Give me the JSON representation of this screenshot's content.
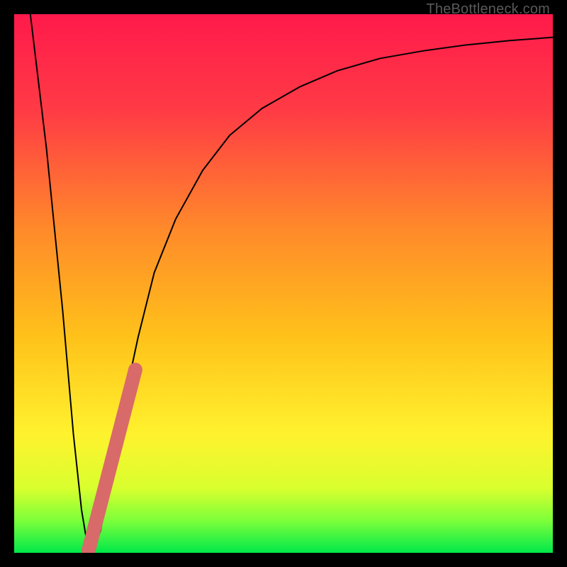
{
  "watermark": "TheBottleneck.com",
  "colors": {
    "frame": "#000000",
    "gradient_stops": [
      {
        "pct": 0,
        "color": "#ff1a4b"
      },
      {
        "pct": 18,
        "color": "#ff3b45"
      },
      {
        "pct": 40,
        "color": "#ff8a2a"
      },
      {
        "pct": 60,
        "color": "#ffc21a"
      },
      {
        "pct": 78,
        "color": "#fff22e"
      },
      {
        "pct": 88,
        "color": "#d9ff2e"
      },
      {
        "pct": 94,
        "color": "#7dff3a"
      },
      {
        "pct": 100,
        "color": "#00e84a"
      }
    ],
    "curve": "#000000",
    "marker": "#d86a6a"
  },
  "chart_data": {
    "type": "line",
    "title": "",
    "xlabel": "",
    "ylabel": "",
    "xlim": [
      0,
      100
    ],
    "ylim": [
      0,
      100
    ],
    "series": [
      {
        "name": "bottleneck-curve",
        "x": [
          3,
          6,
          9,
          11,
          12.5,
          13.5,
          14.5,
          16,
          18,
          20,
          23,
          26,
          30,
          35,
          40,
          46,
          53,
          60,
          68,
          76,
          84,
          92,
          100
        ],
        "y": [
          100,
          75,
          45,
          22,
          8,
          2,
          0.3,
          4,
          14,
          26,
          40,
          52,
          62,
          71,
          77.5,
          82.5,
          86.5,
          89.5,
          91.8,
          93.2,
          94.3,
          95.1,
          95.7
        ]
      }
    ],
    "marker_segment": {
      "name": "highlight-range",
      "x": [
        13.8,
        22.5
      ],
      "y": [
        0.4,
        34
      ]
    }
  }
}
